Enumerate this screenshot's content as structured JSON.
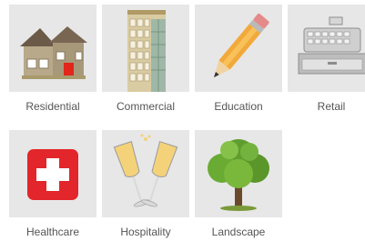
{
  "categories": [
    {
      "label": "Residential",
      "icon": "house-icon"
    },
    {
      "label": "Commercial",
      "icon": "office-building-icon"
    },
    {
      "label": "Education",
      "icon": "pencil-icon"
    },
    {
      "label": "Retail",
      "icon": "cash-register-icon"
    },
    {
      "label": "Healthcare",
      "icon": "medical-cross-icon"
    },
    {
      "label": "Hospitality",
      "icon": "champagne-glasses-icon"
    },
    {
      "label": "Landscape",
      "icon": "tree-icon"
    }
  ],
  "colors": {
    "tile_background": "#e7e7e7",
    "label_text": "#555555",
    "healthcare_red": "#e2262b"
  }
}
